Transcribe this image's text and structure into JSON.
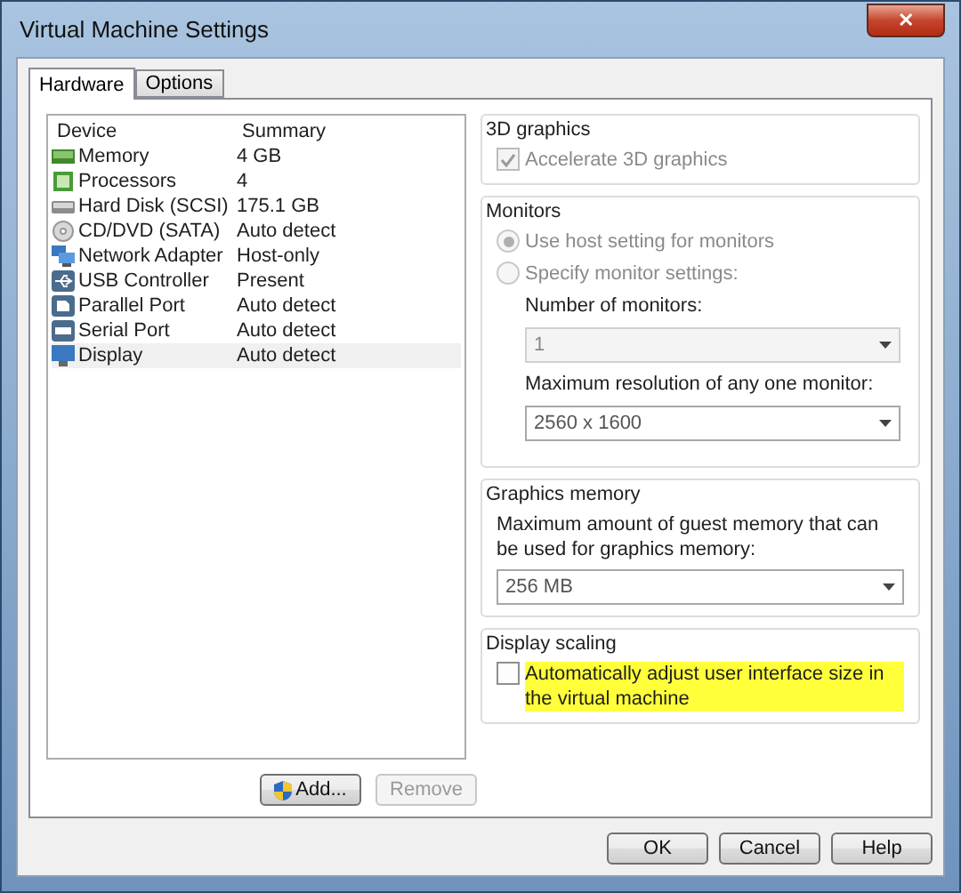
{
  "window": {
    "title": "Virtual Machine Settings",
    "close_label": "✕"
  },
  "tabs": [
    {
      "label": "Hardware",
      "selected": true
    },
    {
      "label": "Options",
      "selected": false
    }
  ],
  "devices": {
    "columns": [
      "Device",
      "Summary"
    ],
    "rows": [
      {
        "kind": "memory",
        "name": "Memory",
        "summary": "4 GB",
        "selected": false
      },
      {
        "kind": "processor",
        "name": "Processors",
        "summary": "4",
        "selected": false
      },
      {
        "kind": "disk",
        "name": "Hard Disk (SCSI)",
        "summary": "175.1 GB",
        "selected": false
      },
      {
        "kind": "cd",
        "name": "CD/DVD (SATA)",
        "summary": "Auto detect",
        "selected": false
      },
      {
        "kind": "network",
        "name": "Network Adapter",
        "summary": "Host-only",
        "selected": false
      },
      {
        "kind": "usb",
        "name": "USB Controller",
        "summary": "Present",
        "selected": false
      },
      {
        "kind": "parallel",
        "name": "Parallel Port",
        "summary": "Auto detect",
        "selected": false
      },
      {
        "kind": "serial",
        "name": "Serial Port",
        "summary": "Auto detect",
        "selected": false
      },
      {
        "kind": "display",
        "name": "Display",
        "summary": "Auto detect",
        "selected": true
      }
    ],
    "buttons": [
      {
        "label": "Add...",
        "disabled": false,
        "icon": true
      },
      {
        "label": "Remove",
        "disabled": true,
        "icon": false
      }
    ]
  },
  "graphics_3d": {
    "title": "3D graphics",
    "checkbox": {
      "label": "Accelerate 3D graphics",
      "checked": true,
      "disabled": true
    }
  },
  "monitors": {
    "title": "Monitors",
    "options": [
      {
        "label": "Use host setting for monitors",
        "selected": true,
        "disabled": true
      },
      {
        "label": "Specify monitor settings:",
        "selected": false,
        "disabled": true
      }
    ],
    "number_label": "Number of monitors:",
    "number_value": "1",
    "number_disabled": true,
    "resolution_label": "Maximum resolution of any one monitor:",
    "resolution_value": "2560 x 1600",
    "resolution_disabled": false
  },
  "graphics_memory": {
    "title": "Graphics memory",
    "description": "Maximum amount of guest memory that can be used for graphics memory:",
    "value": "256 MB",
    "disabled": false
  },
  "display_scaling": {
    "title": "Display scaling",
    "checkbox": {
      "label": "Automatically adjust user interface size in the virtual machine",
      "checked": false,
      "disabled": false,
      "highlighted": true
    }
  },
  "dialog_buttons": [
    "OK",
    "Cancel",
    "Help"
  ]
}
